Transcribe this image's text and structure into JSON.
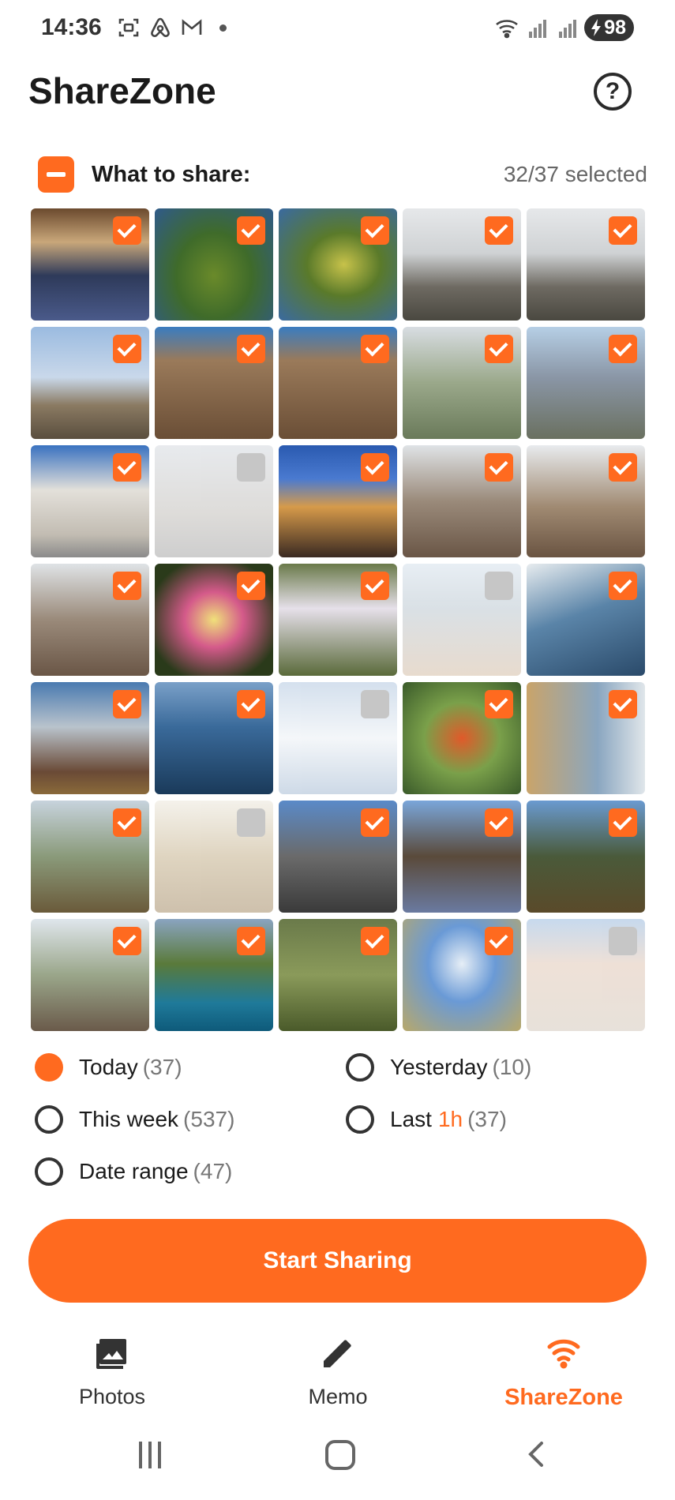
{
  "status_bar": {
    "time": "14:36",
    "battery": "98",
    "icons_left": [
      "screenshot-icon",
      "airbnb-icon",
      "gmail-icon",
      "dot-icon"
    ],
    "icons_right": [
      "wifi-icon",
      "signal-icon",
      "signal-icon",
      "battery-charging-icon"
    ]
  },
  "header": {
    "title": "ShareZone",
    "help_label": "?"
  },
  "share": {
    "label": "What to share:",
    "selected": "32/37 selected"
  },
  "photos": [
    {
      "image": "airplane-cabin",
      "selected": true
    },
    {
      "image": "pine-tree",
      "selected": true
    },
    {
      "image": "forest-tree",
      "selected": true
    },
    {
      "image": "prambanan-temple",
      "selected": true
    },
    {
      "image": "prambanan-temple",
      "selected": true
    },
    {
      "image": "mosque",
      "selected": true
    },
    {
      "image": "cathedral-facade",
      "selected": true
    },
    {
      "image": "cathedral-facade",
      "selected": true
    },
    {
      "image": "palace-gardens-aerial",
      "selected": true
    },
    {
      "image": "city-skyline",
      "selected": true
    },
    {
      "image": "parliament-building",
      "selected": true
    },
    {
      "image": "palace-aerial",
      "selected": false
    },
    {
      "image": "brandenburg-gate",
      "selected": true
    },
    {
      "image": "borobudur-stupa",
      "selected": true
    },
    {
      "image": "borobudur-stupas",
      "selected": true
    },
    {
      "image": "buddha-statue",
      "selected": true
    },
    {
      "image": "orchid",
      "selected": true
    },
    {
      "image": "white-flowers",
      "selected": true
    },
    {
      "image": "beach-aerial",
      "selected": false
    },
    {
      "image": "coastline",
      "selected": true
    },
    {
      "image": "volcano-crater",
      "selected": true
    },
    {
      "image": "volcano-blue",
      "selected": true
    },
    {
      "image": "smoking-volcano",
      "selected": false
    },
    {
      "image": "offering-basket",
      "selected": true
    },
    {
      "image": "cliff-wall",
      "selected": true
    },
    {
      "image": "sea-cliff",
      "selected": true
    },
    {
      "image": "carved-statue",
      "selected": false
    },
    {
      "image": "temple-gate",
      "selected": true
    },
    {
      "image": "ulun-danu-pagoda",
      "selected": true
    },
    {
      "image": "balinese-shrine",
      "selected": true
    },
    {
      "image": "white-stupa",
      "selected": true
    },
    {
      "image": "tanah-lot",
      "selected": true
    },
    {
      "image": "rice-terrace",
      "selected": true
    },
    {
      "image": "blue-flowers",
      "selected": true
    },
    {
      "image": "rock-arch",
      "selected": false
    }
  ],
  "options": {
    "today": {
      "label": "Today",
      "count": "(37)",
      "selected": true
    },
    "yesterday": {
      "label": "Yesterday",
      "count": "(10)",
      "selected": false
    },
    "this_week": {
      "label": "This week",
      "count": "(537)",
      "selected": false
    },
    "last": {
      "label": "Last",
      "accent": "1h",
      "count": "(37)",
      "selected": false
    },
    "date_range": {
      "label": "Date range",
      "count": "(47)",
      "selected": false
    }
  },
  "start_button": "Start Sharing",
  "nav": {
    "photos": "Photos",
    "memo": "Memo",
    "sharezone": "ShareZone",
    "active": "sharezone"
  },
  "colors": {
    "accent": "#ff6a1f",
    "text": "#1a1a1a",
    "muted": "#777777"
  }
}
